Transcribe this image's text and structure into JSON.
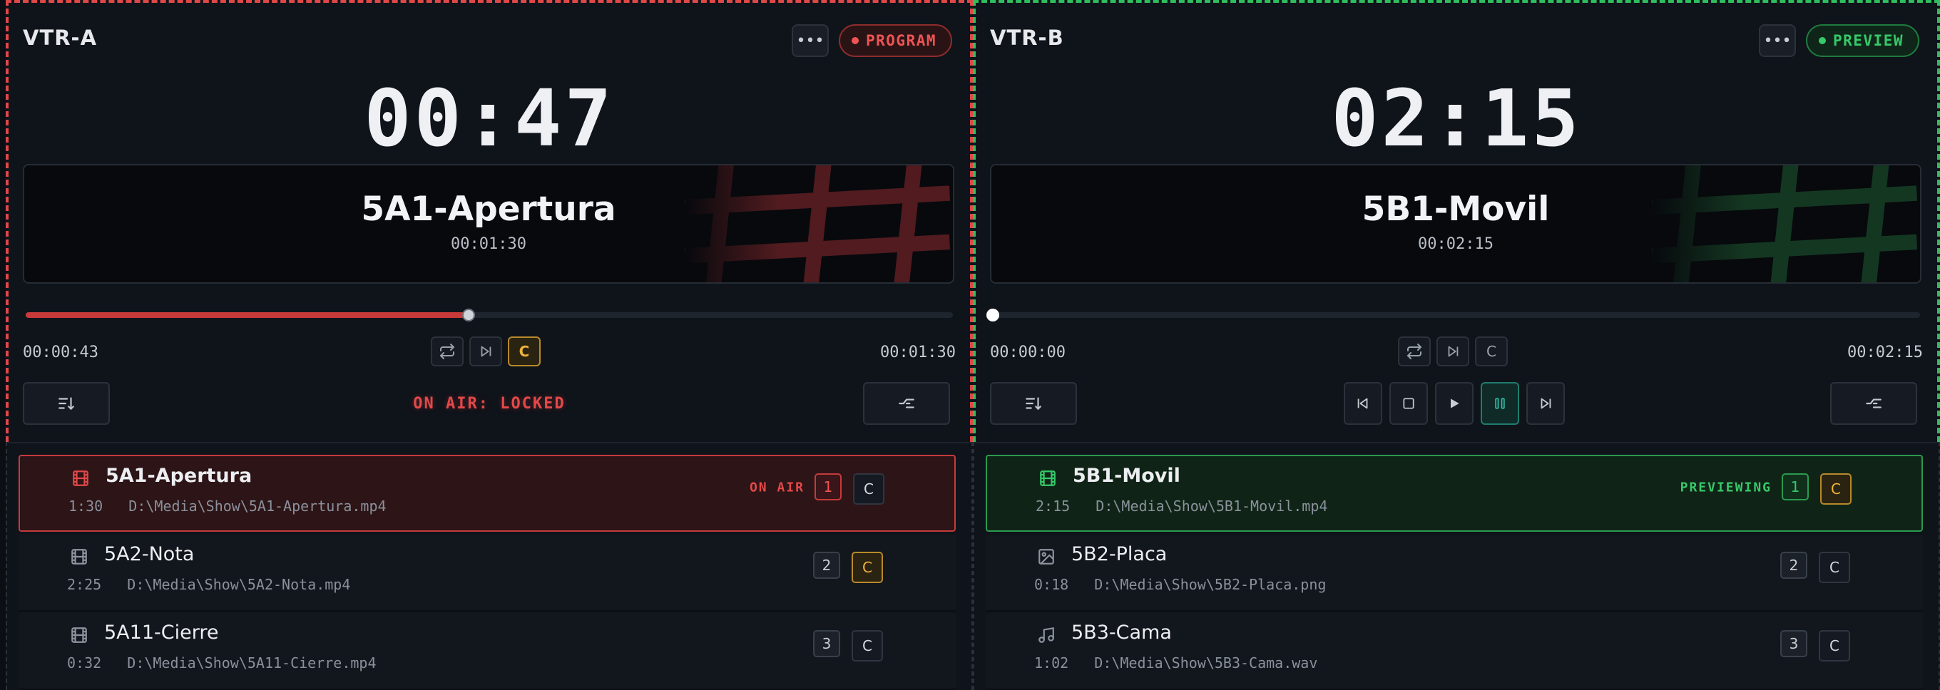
{
  "vtr_a": {
    "name": "VTR-A",
    "menu_glyph": "•••",
    "state": "PROGRAM",
    "clock": "00:47",
    "clip_name": "5A1-Apertura",
    "clip_duration": "00:01:30",
    "progress": 0.4778,
    "elapsed": "00:00:43",
    "total": "00:01:30",
    "c_label": "C",
    "lock_text": "ON AIR: LOCKED",
    "accent": "#e04848",
    "playlist": [
      {
        "name": "5A1-Apertura",
        "duration": "1:30",
        "path": "D:\\Media\\Show\\5A1-Apertura.mp4",
        "icon": "film-icon",
        "status": "ON AIR",
        "index": "1",
        "c_label": "C",
        "c_active": false
      },
      {
        "name": "5A2-Nota",
        "duration": "2:25",
        "path": "D:\\Media\\Show\\5A2-Nota.mp4",
        "icon": "film-icon",
        "status": "",
        "index": "2",
        "c_label": "C",
        "c_active": true
      },
      {
        "name": "5A11-Cierre",
        "duration": "0:32",
        "path": "D:\\Media\\Show\\5A11-Cierre.mp4",
        "icon": "film-icon",
        "status": "",
        "index": "3",
        "c_label": "C",
        "c_active": false
      }
    ]
  },
  "vtr_b": {
    "name": "VTR-B",
    "menu_glyph": "•••",
    "state": "PREVIEW",
    "clock": "02:15",
    "clip_name": "5B1-Movil",
    "clip_duration": "00:02:15",
    "progress": 0,
    "elapsed": "00:00:00",
    "total": "00:02:15",
    "c_label": "C",
    "accent": "#2fbe5e",
    "playlist": [
      {
        "name": "5B1-Movil",
        "duration": "2:15",
        "path": "D:\\Media\\Show\\5B1-Movil.mp4",
        "icon": "film-icon",
        "status": "PREVIEWING",
        "index": "1",
        "c_label": "C",
        "c_active": true
      },
      {
        "name": "5B2-Placa",
        "duration": "0:18",
        "path": "D:\\Media\\Show\\5B2-Placa.png",
        "icon": "image-icon",
        "status": "",
        "index": "2",
        "c_label": "C",
        "c_active": false
      },
      {
        "name": "5B3-Cama",
        "duration": "1:02",
        "path": "D:\\Media\\Show\\5B3-Cama.wav",
        "icon": "music-icon",
        "status": "",
        "index": "3",
        "c_label": "C",
        "c_active": false
      }
    ]
  }
}
